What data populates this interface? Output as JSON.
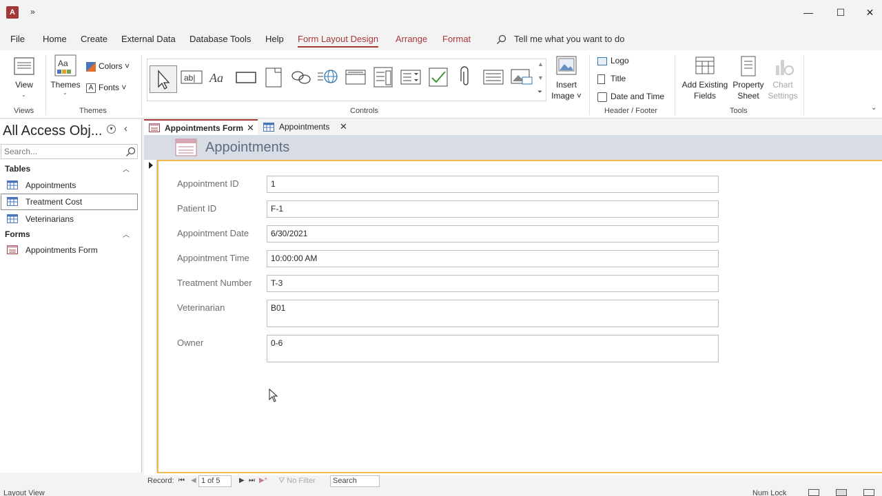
{
  "window": {
    "app_icon": "A",
    "qat_more": "»",
    "minimize": "—",
    "maximize": "☐",
    "close": "✕"
  },
  "menu": {
    "tabs": [
      "File",
      "Home",
      "Create",
      "External Data",
      "Database Tools",
      "Help",
      "Form Layout Design",
      "Arrange",
      "Format"
    ],
    "tell_me": "Tell me what you want to do"
  },
  "ribbon": {
    "views": {
      "button": "View",
      "group": "Views"
    },
    "themes": {
      "button": "Themes",
      "colors": "Colors",
      "fonts": "Fonts",
      "group": "Themes"
    },
    "controls": {
      "group": "Controls",
      "insert_image_line1": "Insert",
      "insert_image_line2": "Image"
    },
    "header_footer": {
      "logo": "Logo",
      "title": "Title",
      "date_time": "Date and Time",
      "group": "Header / Footer"
    },
    "tools": {
      "add_fields_line1": "Add Existing",
      "add_fields_line2": "Fields",
      "property_line1": "Property",
      "property_line2": "Sheet",
      "chart_line1": "Chart",
      "chart_line2": "Settings",
      "group": "Tools"
    }
  },
  "nav": {
    "title": "All Access Obj...",
    "search_placeholder": "Search...",
    "sections": [
      {
        "title": "Tables",
        "items": [
          "Appointments",
          "Treatment Cost",
          "Veterinarians"
        ]
      },
      {
        "title": "Forms",
        "items": [
          "Appointments Form"
        ]
      }
    ]
  },
  "doc_tabs": [
    "Appointments Form",
    "Appointments"
  ],
  "form": {
    "title": "Appointments",
    "fields": [
      {
        "label": "Appointment ID",
        "value": "1"
      },
      {
        "label": "Patient ID",
        "value": "F-1"
      },
      {
        "label": "Appointment Date",
        "value": "6/30/2021"
      },
      {
        "label": "Appointment Time",
        "value": "10:00:00 AM"
      },
      {
        "label": "Treatment Number",
        "value": "T-3"
      },
      {
        "label": "Veterinarian",
        "value": "B01"
      },
      {
        "label": "Owner",
        "value": "0-6"
      }
    ]
  },
  "record_nav": {
    "label": "Record:",
    "position": "1 of 5",
    "filter": "No Filter",
    "search": "Search"
  },
  "status": {
    "view": "Layout View",
    "num_lock": "Num Lock"
  }
}
